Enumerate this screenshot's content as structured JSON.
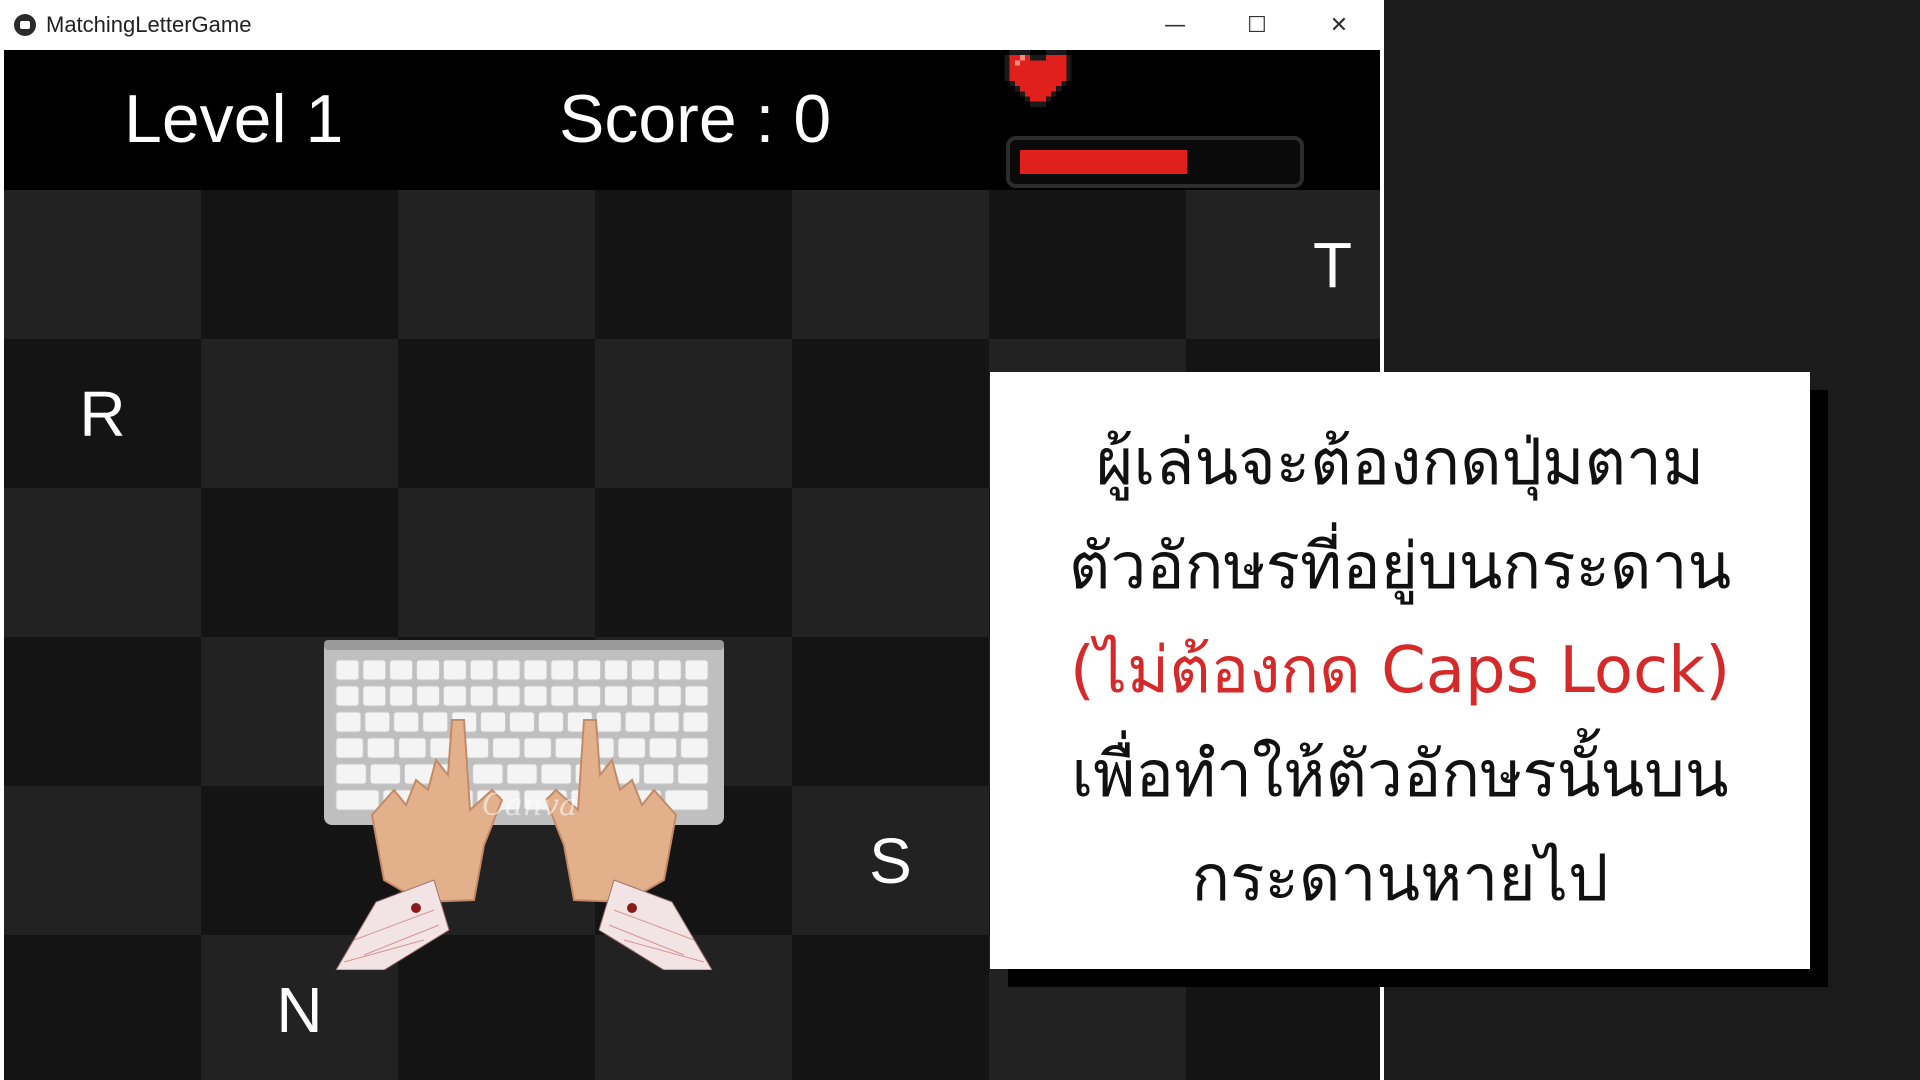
{
  "window": {
    "title": "MatchingLetterGame",
    "minimize": "—",
    "maximize": "☐",
    "close": "✕"
  },
  "hud": {
    "level": "Level 1",
    "score": "Score : 0",
    "health_fraction": 0.62,
    "health_color": "#e0201c",
    "heart_icon": "heart-icon"
  },
  "board": {
    "columns": 7,
    "rows": 6,
    "letters": [
      {
        "row": 0,
        "col": 6,
        "char": "T"
      },
      {
        "row": 1,
        "col": 0,
        "char": "R"
      },
      {
        "row": 4,
        "col": 4,
        "char": "S"
      },
      {
        "row": 5,
        "col": 1,
        "char": "N"
      }
    ]
  },
  "illustration": {
    "icon": "keyboard-hands-icon",
    "watermark": "Canva"
  },
  "instruction": {
    "lines": [
      {
        "text": "ผู้เล่นจะต้องกดปุ่มตาม",
        "color": "#111111"
      },
      {
        "text": "ตัวอักษรที่อยู่บนกระดาน",
        "color": "#111111"
      },
      {
        "text": "(ไม่ต้องกด Caps Lock)",
        "color": "#d42a2a"
      },
      {
        "text": "เพื่อทำให้ตัวอักษรนั้นบน",
        "color": "#111111"
      },
      {
        "text": "กระดานหายไป",
        "color": "#111111"
      }
    ]
  }
}
